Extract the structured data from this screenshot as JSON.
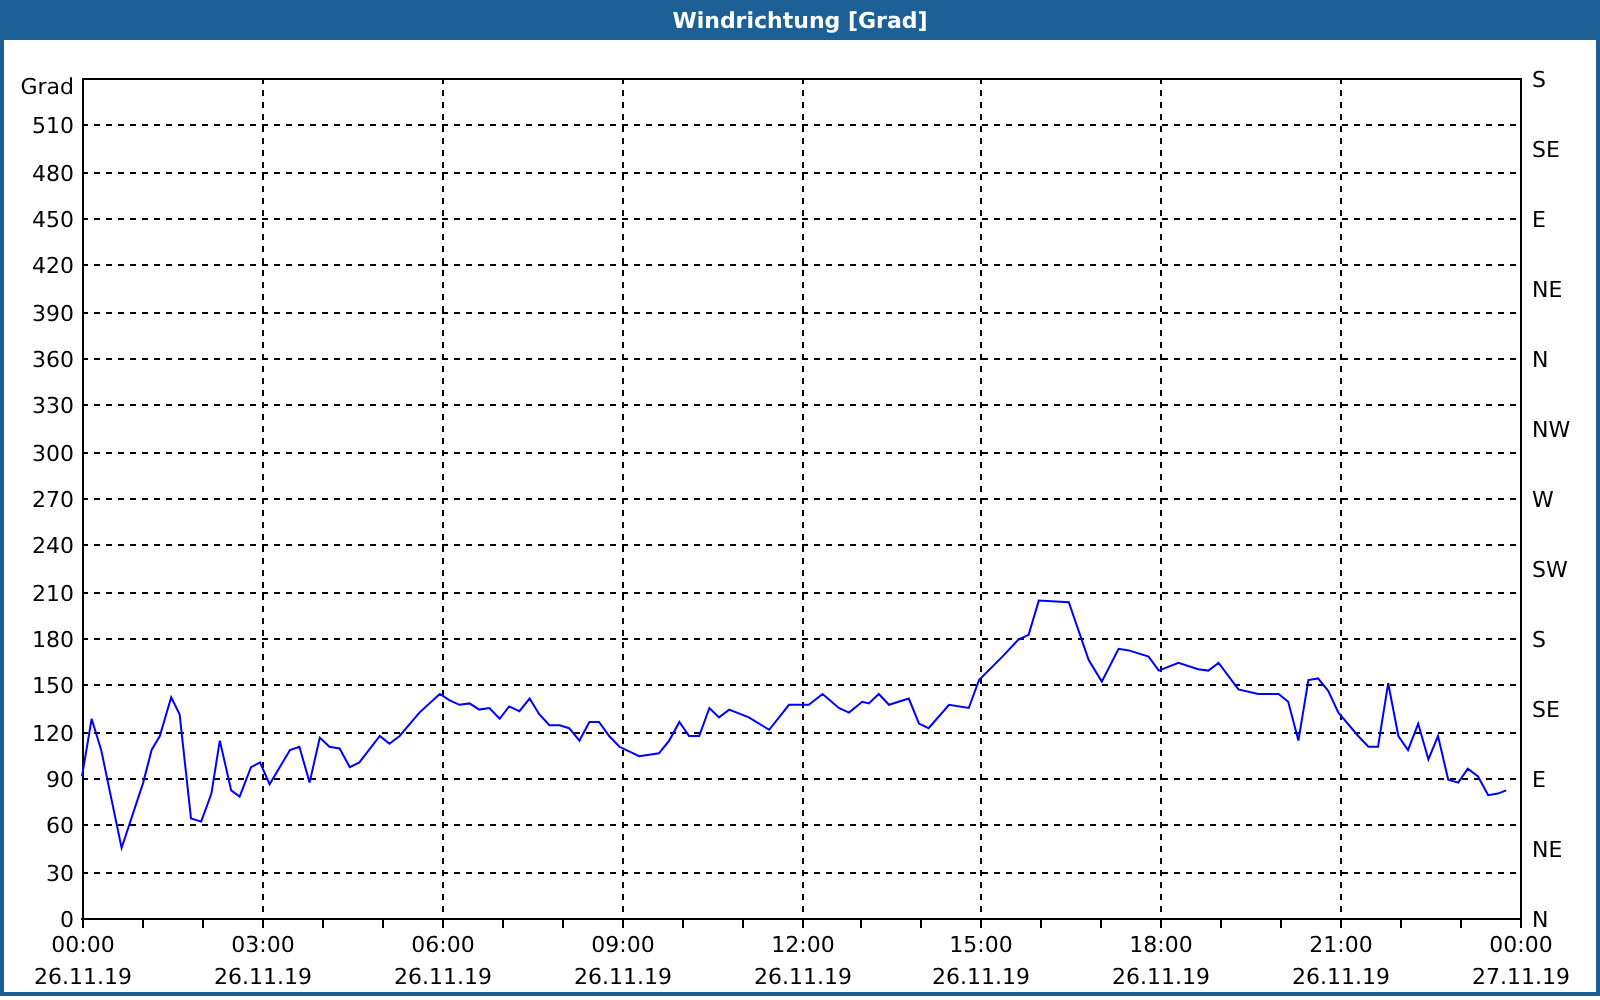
{
  "window": {
    "title": "Windrichtung [Grad]"
  },
  "chart": {
    "chart_data": {
      "type": "line",
      "grid": true,
      "ylabel": "Grad",
      "xlim": [
        0,
        24
      ],
      "ylim": [
        0,
        540
      ],
      "xticks": [
        {
          "value": 0,
          "label": "00:00"
        },
        {
          "value": 3,
          "label": "03:00"
        },
        {
          "value": 6,
          "label": "06:00"
        },
        {
          "value": 9,
          "label": "09:00"
        },
        {
          "value": 12,
          "label": "12:00"
        },
        {
          "value": 15,
          "label": "15:00"
        },
        {
          "value": 18,
          "label": "18:00"
        },
        {
          "value": 21,
          "label": "21:00"
        },
        {
          "value": 24,
          "label": "00:00"
        }
      ],
      "yticks": [
        0,
        30,
        60,
        90,
        120,
        150,
        180,
        210,
        240,
        270,
        300,
        330,
        360,
        390,
        420,
        450,
        480,
        510
      ],
      "x": [
        0,
        0.16,
        0.32,
        0.66,
        1.02,
        1.16,
        1.3,
        1.49,
        1.63,
        1.82,
        1.99,
        2.16,
        2.3,
        2.49,
        2.63,
        2.82,
        2.97,
        3.13,
        3.47,
        3.63,
        3.8,
        3.97,
        4.13,
        4.3,
        4.47,
        4.63,
        4.97,
        5.13,
        5.3,
        5.63,
        5.97,
        6.13,
        6.3,
        6.47,
        6.63,
        6.8,
        6.97,
        7.13,
        7.3,
        7.47,
        7.63,
        7.8,
        7.97,
        8.13,
        8.3,
        8.47,
        8.63,
        8.8,
        8.97,
        9.3,
        9.63,
        9.8,
        9.97,
        10.13,
        10.3,
        10.47,
        10.63,
        10.8,
        11.13,
        11.47,
        11.8,
        12.13,
        12.36,
        12.63,
        12.8,
        13.02,
        13.13,
        13.3,
        13.47,
        13.8,
        13.97,
        14.13,
        14.47,
        14.8,
        14.97,
        15.36,
        15.63,
        15.8,
        15.97,
        16.47,
        16.8,
        17.02,
        17.3,
        17.47,
        17.8,
        17.97,
        18.3,
        18.63,
        18.8,
        18.97,
        19.3,
        19.63,
        19.97,
        20.13,
        20.3,
        20.47,
        20.63,
        20.8,
        20.97,
        21.3,
        21.47,
        21.63,
        21.8,
        21.97,
        22.13,
        22.3,
        22.47,
        22.63,
        22.8,
        22.97,
        23.13,
        23.3,
        23.47,
        23.63,
        23.77
      ],
      "series": [
        {
          "color": "#0000ff",
          "values": [
            91,
            128,
            108,
            45,
            87,
            108,
            117,
            142,
            131,
            64,
            62,
            80,
            114,
            82,
            78,
            97,
            100,
            86,
            108,
            110,
            87,
            116,
            110,
            109,
            97,
            100,
            117,
            112,
            117,
            132,
            144,
            140,
            137,
            138,
            134,
            135,
            128,
            136,
            133,
            141,
            131,
            124,
            124,
            122,
            114,
            126,
            126,
            117,
            110,
            104,
            106,
            114,
            126,
            117,
            117,
            135,
            129,
            134,
            129,
            121,
            137,
            137,
            144,
            135,
            132,
            139,
            138,
            144,
            137,
            141,
            125,
            122,
            137,
            135,
            153,
            168,
            179,
            182,
            204,
            203,
            166,
            152,
            173,
            172,
            168,
            159,
            164,
            160,
            159,
            164,
            147,
            144,
            144,
            139,
            114,
            153,
            154,
            146,
            132,
            117,
            110,
            110,
            151,
            117,
            108,
            125,
            102,
            117,
            89,
            87,
            96,
            91,
            79,
            80,
            82
          ]
        }
      ]
    },
    "x_dates": [
      "26.11.19",
      "26.11.19",
      "26.11.19",
      "26.11.19",
      "26.11.19",
      "26.11.19",
      "26.11.19",
      "26.11.19",
      "27.11.19"
    ],
    "compass_labels": [
      "S",
      "SE",
      "E",
      "NE",
      "N",
      "NW",
      "W",
      "SW",
      "S",
      "SE",
      "E",
      "NE",
      "N"
    ]
  }
}
